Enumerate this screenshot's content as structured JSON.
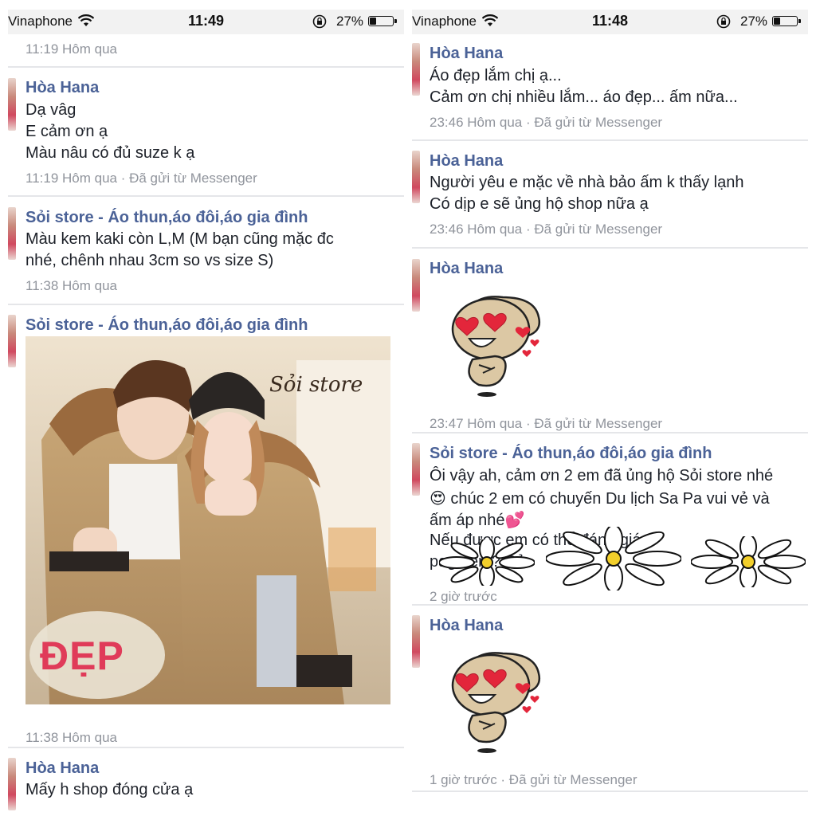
{
  "left": {
    "status_bar": {
      "carrier": "Vinaphone",
      "time": "11:49",
      "battery_percent": "27%",
      "battery_level": 0.27
    },
    "top_meta": "11:19 Hôm qua",
    "messages": [
      {
        "sender": "Hòa Hana",
        "lines": [
          "Dạ vâg",
          "E cảm ơn ạ",
          "Màu nâu có đủ suze k ạ"
        ],
        "meta": "11:19 Hôm qua · Đã gửi từ Messenger"
      },
      {
        "sender": "Sỏi store - Áo thun,áo đôi,áo gia đình",
        "lines": [
          "Màu kem kaki còn L,M (M bạn cũng mặc đc",
          "nhé, chênh nhau 3cm so vs size S)"
        ],
        "meta": "11:38 Hôm qua"
      },
      {
        "sender": "Sỏi store - Áo thun,áo đôi,áo gia đình",
        "photo": {
          "watermark": "Sỏi store",
          "badge": "ĐẸP"
        },
        "meta": "11:38 Hôm qua"
      },
      {
        "sender": "Hòa Hana",
        "lines": [
          "Mấy h shop đóng cửa ạ"
        ]
      }
    ]
  },
  "right": {
    "status_bar": {
      "carrier": "Vinaphone",
      "time": "11:48",
      "battery_percent": "27%",
      "battery_level": 0.27
    },
    "messages": [
      {
        "sender": "Hòa Hana",
        "lines": [
          "Áo đẹp lắm chị ạ...",
          "Cảm ơn chị nhiều lắm... áo đẹp... ấm nữa..."
        ],
        "meta": "23:46 Hôm qua · Đã gửi từ Messenger"
      },
      {
        "sender": "Hòa Hana",
        "lines": [
          "Người yêu e mặc về nhà bảo ấm k thấy lạnh",
          "Có dịp e sẽ ủng hộ shop nữa ạ"
        ],
        "meta": "23:46 Hôm qua · Đã gửi từ Messenger"
      },
      {
        "sender": "Hòa Hana",
        "sticker": "heart-eyes-dog-sticker",
        "meta": "23:47 Hôm qua · Đã gửi từ Messenger"
      },
      {
        "sender": "Sỏi store - Áo thun,áo đôi,áo gia đình",
        "lines": [
          "Ôi vậy ah, cảm ơn 2 em đã ủng hộ Sỏi store nhé",
          "😍 chúc 2 em có chuyến Du lịch Sa Pa vui vẻ và",
          "ấm áp nhé💕",
          "Nếu được em có thể đánh giá",
          "page em? Cả"
        ],
        "meta": "2 giờ trước"
      },
      {
        "sender": "Hòa Hana",
        "sticker": "heart-eyes-dog-sticker",
        "meta": "1 giờ trước · Đã gửi từ Messenger"
      }
    ]
  }
}
